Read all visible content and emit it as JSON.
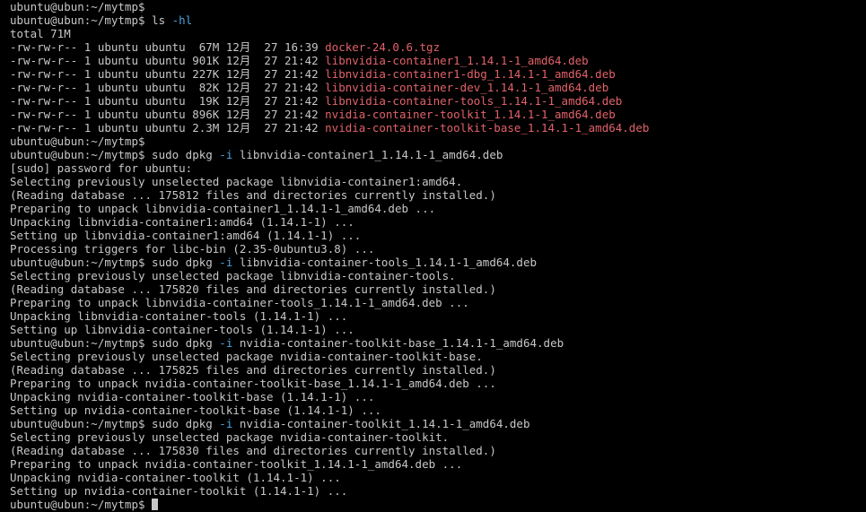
{
  "colors": {
    "background": "#000000",
    "text": "#c7c7c7",
    "flag": "#4ea3d9",
    "file": "#e2626a"
  },
  "terminal": {
    "lines": [
      [
        {
          "t": "ubuntu@ubun:~/mytmp$",
          "c": "text"
        }
      ],
      [
        {
          "t": "ubuntu@ubun:~/mytmp$ ls ",
          "c": "text"
        },
        {
          "t": "-hl",
          "c": "flag"
        }
      ],
      [
        {
          "t": "total 71M",
          "c": "text"
        }
      ],
      [
        {
          "t": "-rw-rw-r-- 1 ubuntu ubuntu  67M 12月  27 16:39 ",
          "c": "text"
        },
        {
          "t": "docker-24.0.6.tgz",
          "c": "file"
        }
      ],
      [
        {
          "t": "-rw-rw-r-- 1 ubuntu ubuntu 901K 12月  27 21:42 ",
          "c": "text"
        },
        {
          "t": "libnvidia-container1_1.14.1-1_amd64.deb",
          "c": "file"
        }
      ],
      [
        {
          "t": "-rw-rw-r-- 1 ubuntu ubuntu 227K 12月  27 21:42 ",
          "c": "text"
        },
        {
          "t": "libnvidia-container1-dbg_1.14.1-1_amd64.deb",
          "c": "file"
        }
      ],
      [
        {
          "t": "-rw-rw-r-- 1 ubuntu ubuntu  82K 12月  27 21:42 ",
          "c": "text"
        },
        {
          "t": "libnvidia-container-dev_1.14.1-1_amd64.deb",
          "c": "file"
        }
      ],
      [
        {
          "t": "-rw-rw-r-- 1 ubuntu ubuntu  19K 12月  27 21:42 ",
          "c": "text"
        },
        {
          "t": "libnvidia-container-tools_1.14.1-1_amd64.deb",
          "c": "file"
        }
      ],
      [
        {
          "t": "-rw-rw-r-- 1 ubuntu ubuntu 896K 12月  27 21:42 ",
          "c": "text"
        },
        {
          "t": "nvidia-container-toolkit_1.14.1-1_amd64.deb",
          "c": "file"
        }
      ],
      [
        {
          "t": "-rw-rw-r-- 1 ubuntu ubuntu 2.3M 12月  27 21:42 ",
          "c": "text"
        },
        {
          "t": "nvidia-container-toolkit-base_1.14.1-1_amd64.deb",
          "c": "file"
        }
      ],
      [
        {
          "t": "ubuntu@ubun:~/mytmp$",
          "c": "text"
        }
      ],
      [
        {
          "t": "ubuntu@ubun:~/mytmp$ sudo dpkg ",
          "c": "text"
        },
        {
          "t": "-i",
          "c": "flag"
        },
        {
          "t": " libnvidia-container1_1.14.1-1_amd64.deb",
          "c": "text"
        }
      ],
      [
        {
          "t": "[sudo] password for ubuntu:",
          "c": "text"
        }
      ],
      [
        {
          "t": "Selecting previously unselected package libnvidia-container1:amd64.",
          "c": "text"
        }
      ],
      [
        {
          "t": "(Reading database ... 175812 files and directories currently installed.)",
          "c": "text"
        }
      ],
      [
        {
          "t": "Preparing to unpack libnvidia-container1_1.14.1-1_amd64.deb ...",
          "c": "text"
        }
      ],
      [
        {
          "t": "Unpacking libnvidia-container1:amd64 (1.14.1-1) ...",
          "c": "text"
        }
      ],
      [
        {
          "t": "Setting up libnvidia-container1:amd64 (1.14.1-1) ...",
          "c": "text"
        }
      ],
      [
        {
          "t": "Processing triggers for libc-bin (2.35-0ubuntu3.8) ...",
          "c": "text"
        }
      ],
      [
        {
          "t": "ubuntu@ubun:~/mytmp$ sudo dpkg ",
          "c": "text"
        },
        {
          "t": "-i",
          "c": "flag"
        },
        {
          "t": " libnvidia-container-tools_1.14.1-1_amd64.deb",
          "c": "text"
        }
      ],
      [
        {
          "t": "Selecting previously unselected package libnvidia-container-tools.",
          "c": "text"
        }
      ],
      [
        {
          "t": "(Reading database ... 175820 files and directories currently installed.)",
          "c": "text"
        }
      ],
      [
        {
          "t": "Preparing to unpack libnvidia-container-tools_1.14.1-1_amd64.deb ...",
          "c": "text"
        }
      ],
      [
        {
          "t": "Unpacking libnvidia-container-tools (1.14.1-1) ...",
          "c": "text"
        }
      ],
      [
        {
          "t": "Setting up libnvidia-container-tools (1.14.1-1) ...",
          "c": "text"
        }
      ],
      [
        {
          "t": "ubuntu@ubun:~/mytmp$ sudo dpkg ",
          "c": "text"
        },
        {
          "t": "-i",
          "c": "flag"
        },
        {
          "t": " nvidia-container-toolkit-base_1.14.1-1_amd64.deb",
          "c": "text"
        }
      ],
      [
        {
          "t": "Selecting previously unselected package nvidia-container-toolkit-base.",
          "c": "text"
        }
      ],
      [
        {
          "t": "(Reading database ... 175825 files and directories currently installed.)",
          "c": "text"
        }
      ],
      [
        {
          "t": "Preparing to unpack nvidia-container-toolkit-base_1.14.1-1_amd64.deb ...",
          "c": "text"
        }
      ],
      [
        {
          "t": "Unpacking nvidia-container-toolkit-base (1.14.1-1) ...",
          "c": "text"
        }
      ],
      [
        {
          "t": "Setting up nvidia-container-toolkit-base (1.14.1-1) ...",
          "c": "text"
        }
      ],
      [
        {
          "t": "ubuntu@ubun:~/mytmp$ sudo dpkg ",
          "c": "text"
        },
        {
          "t": "-i",
          "c": "flag"
        },
        {
          "t": " nvidia-container-toolkit_1.14.1-1_amd64.deb",
          "c": "text"
        }
      ],
      [
        {
          "t": "Selecting previously unselected package nvidia-container-toolkit.",
          "c": "text"
        }
      ],
      [
        {
          "t": "(Reading database ... 175830 files and directories currently installed.)",
          "c": "text"
        }
      ],
      [
        {
          "t": "Preparing to unpack nvidia-container-toolkit_1.14.1-1_amd64.deb ...",
          "c": "text"
        }
      ],
      [
        {
          "t": "Unpacking nvidia-container-toolkit (1.14.1-1) ...",
          "c": "text"
        }
      ],
      [
        {
          "t": "Setting up nvidia-container-toolkit (1.14.1-1) ...",
          "c": "text"
        }
      ],
      [
        {
          "t": "ubuntu@ubun:~/mytmp$ ",
          "c": "text"
        }
      ]
    ]
  }
}
